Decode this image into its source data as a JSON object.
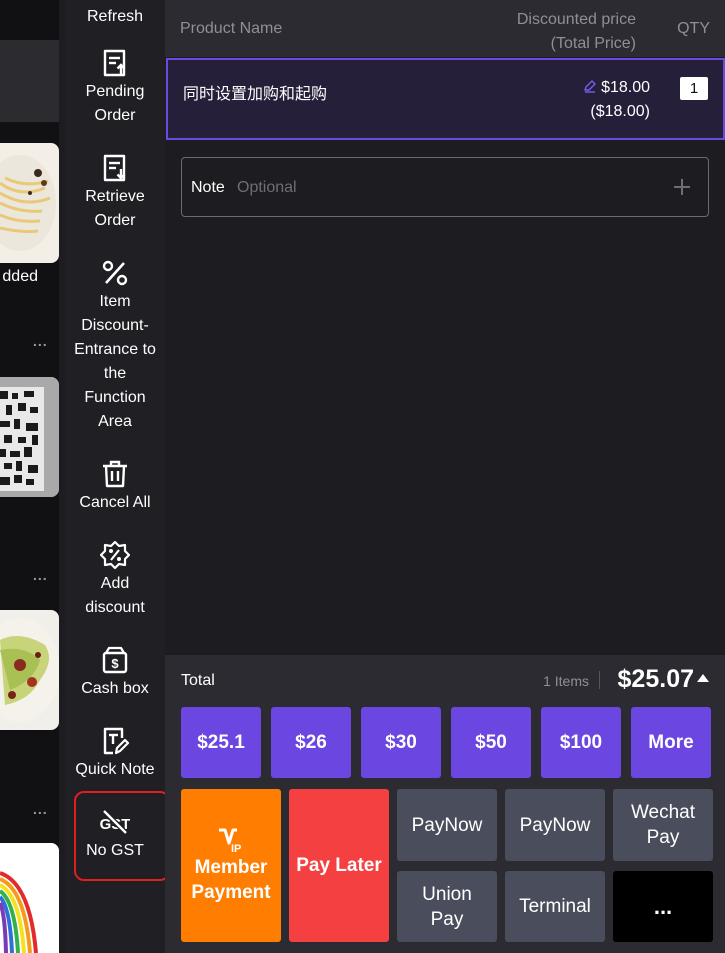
{
  "left_strip": {
    "product_label_fragment": "dded",
    "more_dots": "..."
  },
  "func_menu": {
    "items": [
      {
        "label": "Refresh",
        "icon": "refresh-icon"
      },
      {
        "label": "Pending\nOrder",
        "icon": "pending-order-icon"
      },
      {
        "label": "Retrieve\nOrder",
        "icon": "retrieve-order-icon"
      },
      {
        "label": "Item\nDiscount-\nEntrance to\nthe\nFunction\nArea",
        "icon": "percent-icon"
      },
      {
        "label": "Cancel All",
        "icon": "trash-icon"
      },
      {
        "label": "Add\ndiscount",
        "icon": "discount-badge-icon"
      },
      {
        "label": "Cash box",
        "icon": "cash-box-icon"
      },
      {
        "label": "Quick Note",
        "icon": "quick-note-icon"
      },
      {
        "label": "No GST",
        "icon": "no-gst-icon"
      }
    ]
  },
  "order": {
    "columns": {
      "product_name": "Product Name",
      "price_line1": "Discounted price",
      "price_line2": "(Total Price)",
      "qty": "QTY"
    },
    "items": [
      {
        "name": "同时设置加购和起购",
        "price": "$18.00",
        "total": "($18.00)",
        "qty": "1"
      }
    ],
    "note": {
      "label": "Note",
      "placeholder": "Optional"
    }
  },
  "payment": {
    "total_label": "Total",
    "items_count": "1 Items",
    "total_amount": "$25.07",
    "quick_amounts": [
      "$25.1",
      "$26",
      "$30",
      "$50",
      "$100",
      "More"
    ],
    "methods": {
      "member_line1": "Member",
      "member_line2": "Payment",
      "pay_later": "Pay Later",
      "paynow_1": "PayNow",
      "paynow_2": "PayNow",
      "wechat_line1": "Wechat",
      "wechat_line2": "Pay",
      "union_line1": "Union",
      "union_line2": "Pay",
      "terminal": "Terminal",
      "more": "..."
    }
  },
  "colors": {
    "accent": "#6b46e0",
    "member": "#ff7d00",
    "pay_later": "#f44040",
    "highlight": "#e0201c"
  }
}
